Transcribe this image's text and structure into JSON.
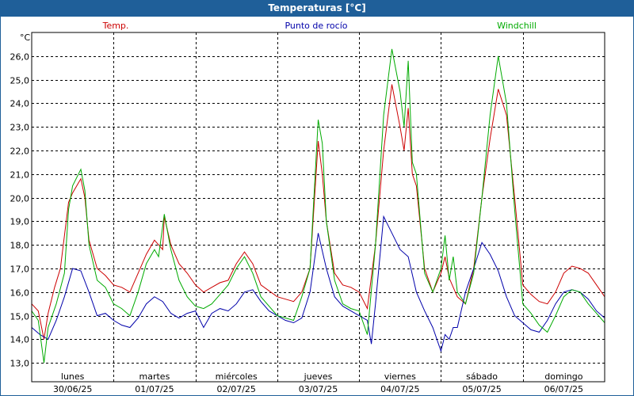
{
  "window": {
    "title": "Temperaturas [°C]"
  },
  "chart_data": {
    "type": "line",
    "title": "Temperaturas [°C]",
    "ylabel": "°C",
    "ylim": [
      12.2,
      27.0
    ],
    "yticks": [
      "13,0",
      "14,0",
      "15,0",
      "16,0",
      "17,0",
      "18,0",
      "19,0",
      "20,0",
      "21,0",
      "22,0",
      "23,0",
      "24,0",
      "25,0",
      "26,0"
    ],
    "ytick_values": [
      13,
      14,
      15,
      16,
      17,
      18,
      19,
      20,
      21,
      22,
      23,
      24,
      25,
      26
    ],
    "xlim": [
      0,
      7.0
    ],
    "day_labels": [
      {
        "day": "lunes",
        "date": "30/06/25"
      },
      {
        "day": "martes",
        "date": "01/07/25"
      },
      {
        "day": "miércoles",
        "date": "02/07/25"
      },
      {
        "day": "jueves",
        "date": "03/07/25"
      },
      {
        "day": "viernes",
        "date": "04/07/25"
      },
      {
        "day": "sábado",
        "date": "05/07/25"
      },
      {
        "day": "domingo",
        "date": "06/07/25"
      }
    ],
    "x_unit": "days since lunes 30/06/25 00:00",
    "grid": true,
    "legend_position": "top",
    "series": [
      {
        "name": "Temp.",
        "color": "#cc0000",
        "x": [
          0,
          0.08,
          0.15,
          0.2,
          0.28,
          0.35,
          0.45,
          0.5,
          0.6,
          0.65,
          0.7,
          0.8,
          0.9,
          1.0,
          1.1,
          1.2,
          1.3,
          1.4,
          1.5,
          1.6,
          1.62,
          1.7,
          1.8,
          1.9,
          2.0,
          2.1,
          2.2,
          2.3,
          2.4,
          2.5,
          2.6,
          2.7,
          2.8,
          3.0,
          3.1,
          3.2,
          3.3,
          3.4,
          3.5,
          3.55,
          3.6,
          3.7,
          3.8,
          3.9,
          4.0,
          4.1,
          4.2,
          4.3,
          4.4,
          4.5,
          4.55,
          4.6,
          4.65,
          4.7,
          4.8,
          4.9,
          5.0,
          5.05,
          5.1,
          5.15,
          5.2,
          5.3,
          5.4,
          5.5,
          5.6,
          5.7,
          5.8,
          5.9,
          6.0,
          6.1,
          6.2,
          6.3,
          6.4,
          6.5,
          6.6,
          6.7,
          6.8,
          6.9,
          7.0
        ],
        "values": [
          15.5,
          15.2,
          14.0,
          15.1,
          16.2,
          17.0,
          19.8,
          20.2,
          20.8,
          20.0,
          18.2,
          17.0,
          16.7,
          16.3,
          16.2,
          16.0,
          16.8,
          17.6,
          18.2,
          17.8,
          19.2,
          18.0,
          17.2,
          16.8,
          16.3,
          16.0,
          16.2,
          16.4,
          16.5,
          17.2,
          17.7,
          17.2,
          16.3,
          15.8,
          15.7,
          15.6,
          16.0,
          17.0,
          22.4,
          21.0,
          19.0,
          16.8,
          16.3,
          16.2,
          16.0,
          15.3,
          18.0,
          22.0,
          24.8,
          23.0,
          22.0,
          23.8,
          21.0,
          20.5,
          17.0,
          16.0,
          16.8,
          17.5,
          16.6,
          16.2,
          15.8,
          15.5,
          17.0,
          20.0,
          22.5,
          24.6,
          23.5,
          20.0,
          16.3,
          15.9,
          15.6,
          15.5,
          16.0,
          16.8,
          17.1,
          17.0,
          16.8,
          16.3,
          15.8
        ]
      },
      {
        "name": "Punto de rocío",
        "color": "#0000aa",
        "x": [
          0,
          0.1,
          0.2,
          0.3,
          0.4,
          0.5,
          0.6,
          0.7,
          0.8,
          0.9,
          1.0,
          1.1,
          1.2,
          1.3,
          1.4,
          1.5,
          1.6,
          1.7,
          1.8,
          1.9,
          2.0,
          2.1,
          2.2,
          2.3,
          2.4,
          2.5,
          2.6,
          2.7,
          2.8,
          2.9,
          3.0,
          3.1,
          3.2,
          3.3,
          3.4,
          3.5,
          3.6,
          3.7,
          3.8,
          3.9,
          4.0,
          4.1,
          4.15,
          4.2,
          4.3,
          4.4,
          4.5,
          4.6,
          4.7,
          4.8,
          4.9,
          5.0,
          5.05,
          5.1,
          5.15,
          5.2,
          5.3,
          5.4,
          5.5,
          5.6,
          5.7,
          5.8,
          5.9,
          6.0,
          6.1,
          6.2,
          6.3,
          6.4,
          6.5,
          6.6,
          6.7,
          6.8,
          6.9,
          7.0
        ],
        "values": [
          14.5,
          14.2,
          14.0,
          14.8,
          15.8,
          17.0,
          16.9,
          16.0,
          15.0,
          15.1,
          14.8,
          14.6,
          14.5,
          14.9,
          15.5,
          15.8,
          15.6,
          15.1,
          14.9,
          15.1,
          15.2,
          14.5,
          15.1,
          15.3,
          15.2,
          15.5,
          16.0,
          16.1,
          15.6,
          15.2,
          15.0,
          14.8,
          14.7,
          14.9,
          16.0,
          18.5,
          17.0,
          15.8,
          15.4,
          15.2,
          15.0,
          14.8,
          13.8,
          15.5,
          19.2,
          18.5,
          17.8,
          17.5,
          16.0,
          15.2,
          14.5,
          13.5,
          14.2,
          14.0,
          14.5,
          14.5,
          16.0,
          17.0,
          18.1,
          17.6,
          16.9,
          15.8,
          15.0,
          14.7,
          14.4,
          14.3,
          14.8,
          15.5,
          16.0,
          16.1,
          16.0,
          15.7,
          15.2,
          14.9
        ]
      },
      {
        "name": "Windchill",
        "color": "#00aa00",
        "x": [
          0,
          0.08,
          0.15,
          0.2,
          0.3,
          0.4,
          0.45,
          0.5,
          0.6,
          0.65,
          0.7,
          0.8,
          0.9,
          1.0,
          1.1,
          1.2,
          1.3,
          1.4,
          1.5,
          1.55,
          1.62,
          1.7,
          1.8,
          1.9,
          2.0,
          2.1,
          2.2,
          2.3,
          2.4,
          2.5,
          2.6,
          2.7,
          2.8,
          3.0,
          3.1,
          3.2,
          3.3,
          3.4,
          3.5,
          3.55,
          3.6,
          3.7,
          3.8,
          3.9,
          4.0,
          4.1,
          4.2,
          4.3,
          4.4,
          4.5,
          4.55,
          4.6,
          4.65,
          4.7,
          4.8,
          4.9,
          5.0,
          5.05,
          5.1,
          5.15,
          5.2,
          5.3,
          5.4,
          5.5,
          5.6,
          5.7,
          5.8,
          5.9,
          6.0,
          6.1,
          6.2,
          6.3,
          6.4,
          6.5,
          6.6,
          6.7,
          6.8,
          6.9,
          7.0
        ],
        "values": [
          15.2,
          14.8,
          13.0,
          14.5,
          15.5,
          16.8,
          19.5,
          20.5,
          21.2,
          20.3,
          18.0,
          16.5,
          16.2,
          15.5,
          15.3,
          15.0,
          16.0,
          17.2,
          17.8,
          17.5,
          19.3,
          17.8,
          16.5,
          15.8,
          15.4,
          15.3,
          15.5,
          15.9,
          16.3,
          17.0,
          17.5,
          16.8,
          15.8,
          15.0,
          14.9,
          14.8,
          15.8,
          17.0,
          23.3,
          22.3,
          19.0,
          16.5,
          15.5,
          15.3,
          15.2,
          14.2,
          18.0,
          23.5,
          26.3,
          24.5,
          23.0,
          25.8,
          21.5,
          21.0,
          16.8,
          16.0,
          17.0,
          18.4,
          16.5,
          17.5,
          16.0,
          15.5,
          16.8,
          20.0,
          23.5,
          26.0,
          24.0,
          19.5,
          15.5,
          15.1,
          14.6,
          14.3,
          15.0,
          15.8,
          16.1,
          16.0,
          15.5,
          15.1,
          14.7
        ]
      }
    ]
  }
}
